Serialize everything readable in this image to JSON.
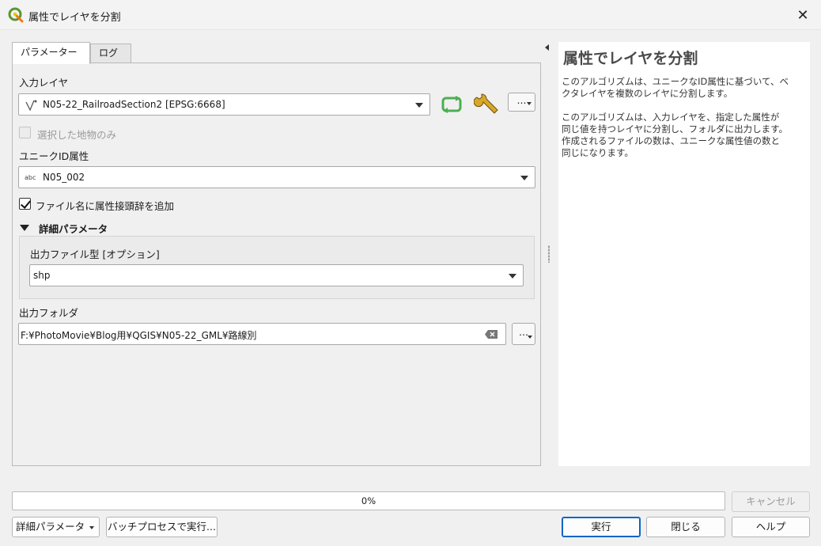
{
  "window": {
    "title": "属性でレイヤを分割",
    "close_glyph": "✕"
  },
  "tabs": [
    {
      "label": "パラメーター",
      "active": true
    },
    {
      "label": "ログ",
      "active": false
    }
  ],
  "params": {
    "input_layer": {
      "label": "入力レイヤ",
      "value": "N05-22_RailroadSection2 [EPSG:6668]",
      "selected_only_label": "選択した地物のみ",
      "selected_only_checked": false,
      "more_button": "…"
    },
    "unique_id": {
      "label": "ユニークID属性",
      "type_tag": "abc",
      "value": "N05_002"
    },
    "prefix_checkbox": {
      "label": "ファイル名に属性接頭辞を追加",
      "checked": true
    },
    "advanced": {
      "label": "詳細パラメータ",
      "output_type_label": "出力ファイル型 [オプション]",
      "output_type_value": "shp"
    },
    "output_folder": {
      "label": "出力フォルダ",
      "value": "F:¥PhotoMovie¥Blog用¥QGIS¥N05-22_GML¥路線別",
      "browse_button": "…"
    }
  },
  "help": {
    "title": "属性でレイヤを分割",
    "paragraph1_line1": "このアルゴリズムは、ユニークなID属性に基づいて、ベ",
    "paragraph1_line2": "クタレイヤを複数のレイヤに分割します。",
    "paragraph2_line1": "このアルゴリズムは、入力レイヤを、指定した属性が",
    "paragraph2_line2": "同じ値を持つレイヤに分割し、フォルダに出力します。",
    "paragraph2_line3": "作成されるファイルの数は、ユニークな属性値の数と",
    "paragraph2_line4": "同じになります。"
  },
  "progress": {
    "text": "0%",
    "value": 0
  },
  "buttons": {
    "cancel": "キャンセル",
    "advanced": "詳細パラメータ",
    "batch": "バッチプロセスで実行...",
    "run": "実行",
    "close": "閉じる",
    "help": "ヘルプ"
  },
  "colors": {
    "accent": "#0a64c8",
    "qgis_green": "#589632",
    "refresh_green": "#4caf50"
  }
}
